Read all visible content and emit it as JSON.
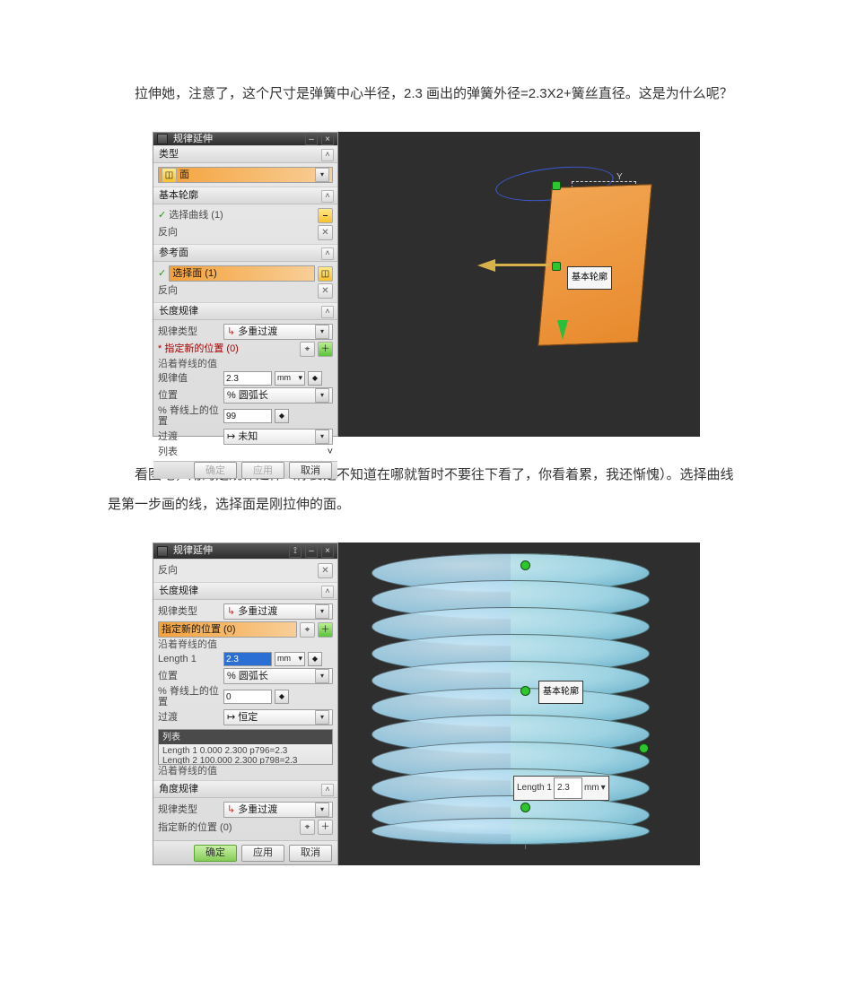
{
  "text": {
    "p1": "拉伸她，注意了，这个尺寸是弹簧中心半径，2.3 画出的弹簧外径=2.3X2+簧丝直径。这是为什么呢？",
    "p2": "看图吧，用的是规律延伸（你要是不知道在哪就暂时不要往下看了，你看着累，我还惭愧）。选择曲线是第一步画的线，选择面是刚拉伸的面。"
  },
  "fig1": {
    "panel_title": "规律延伸",
    "labels": {
      "type": "类型",
      "type_value": "面",
      "base_profile": "基本轮廓",
      "select_curve": "选择曲线 (1)",
      "reverse": "反向",
      "ref_face": "参考面",
      "select_face": "选择面 (1)",
      "reverse2": "反向",
      "length_rule": "长度规律",
      "rule_type": "规律类型",
      "rule_type_value": "多重过渡",
      "new_pos": "指定新的位置 (0)",
      "along_spine": "沿着脊线的值",
      "rule_value": "规律值",
      "rule_value_val": "2.3",
      "rule_value_unit": "mm",
      "pos": "位置",
      "pos_value": "% 圆弧长",
      "pct_on_curve": "% 脊线上的位置",
      "pct_on_curve_val": "99",
      "transition": "过渡",
      "transition_value": "未知",
      "list": "列表",
      "btn_ok": "确定",
      "btn_apply": "应用",
      "btn_cancel": "取消"
    },
    "scene_label": "基本轮廓"
  },
  "fig2": {
    "panel_title": "规律延伸",
    "labels": {
      "reverse": "反向",
      "length_rule": "长度规律",
      "rule_type": "规律类型",
      "rule_type_value": "多重过渡",
      "new_pos": "指定新的位置 (0)",
      "along_spine": "沿着脊线的值",
      "length_param": "Length 1",
      "length_val": "2.3",
      "length_unit": "mm",
      "pos": "位置",
      "pos_value": "% 圆弧长",
      "pct_on_curve": "% 脊线上的位置",
      "pct_on_curve_val": "0",
      "transition": "过渡",
      "transition_value": "恒定",
      "list": "列表",
      "list_rows": [
        "Length 1  0.000      2.300  p796=2.3",
        "Length 2  100.000  2.300  p798=2.3"
      ],
      "angle_rule": "角度规律",
      "rule_type2": "规律类型",
      "rule_type2_value": "多重过渡",
      "new_pos2": "指定新的位置 (0)",
      "along_spine2": "沿着脊线的值",
      "btn_ok": "确定",
      "btn_apply": "应用",
      "btn_cancel": "取消"
    },
    "scene_label": "基本轮廓",
    "float_value": {
      "label": "Length 1",
      "value": "2.3",
      "unit": "mm"
    }
  }
}
